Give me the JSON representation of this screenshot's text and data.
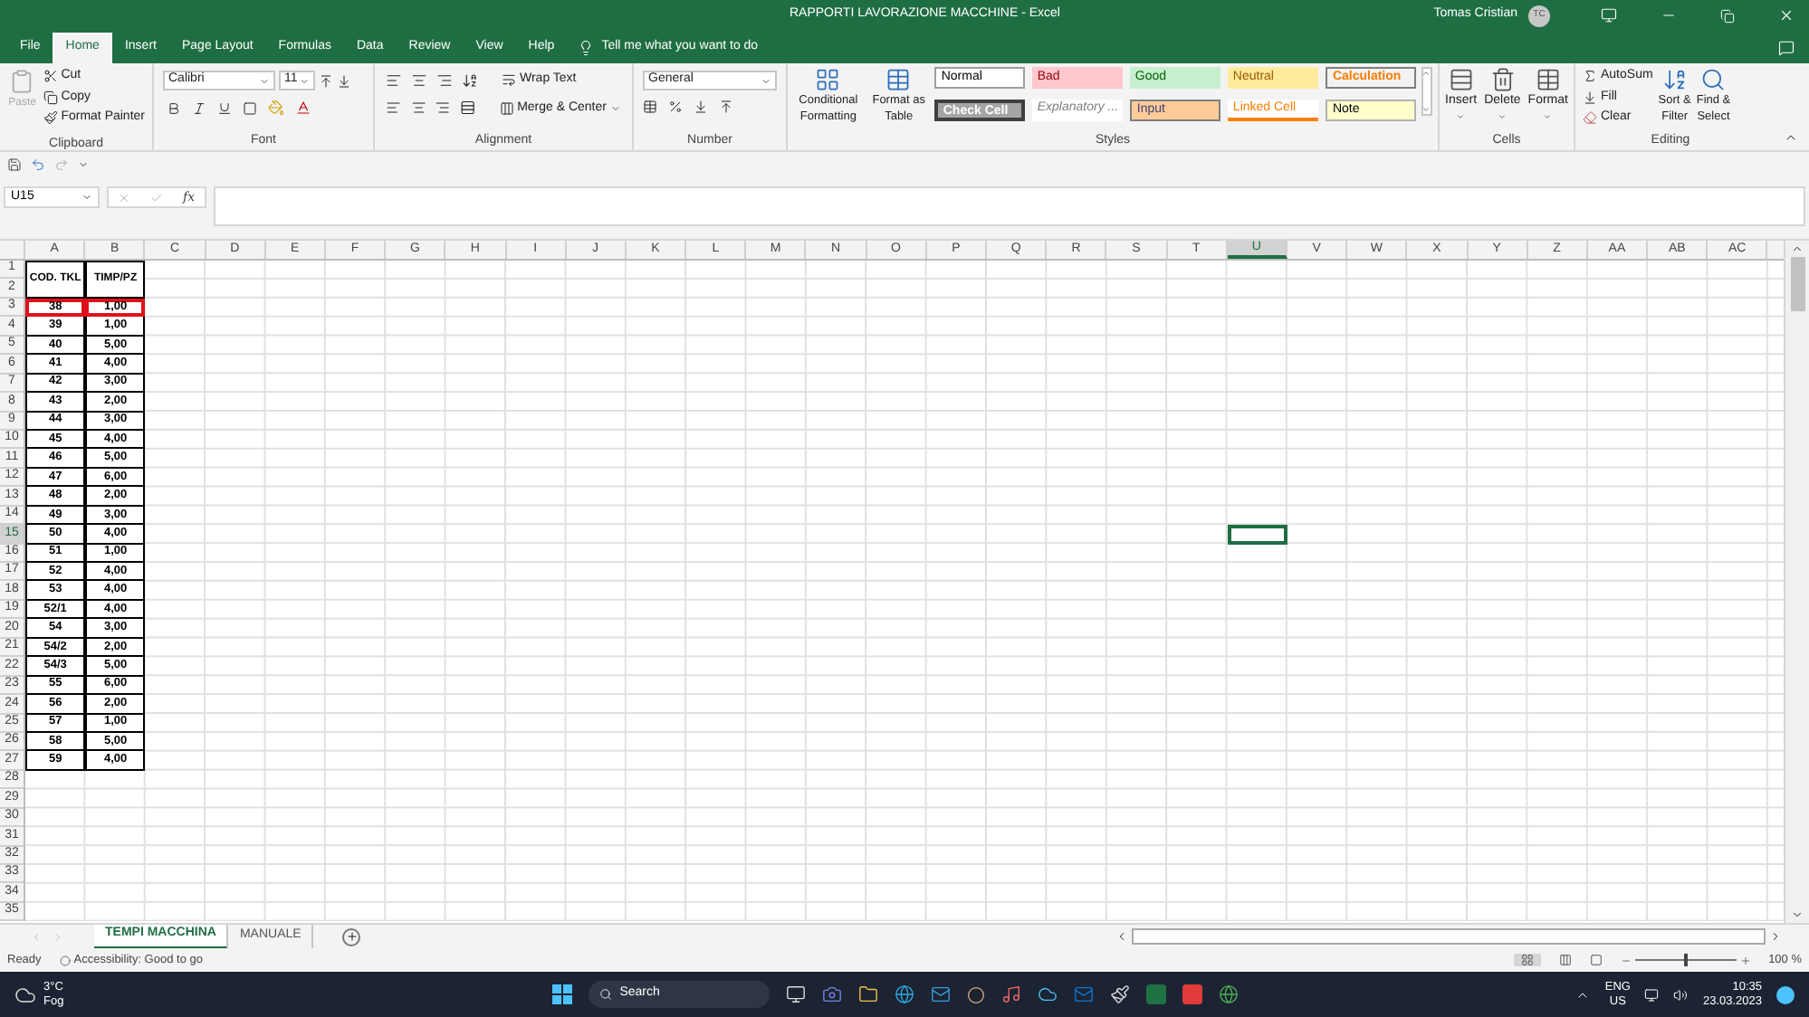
{
  "window": {
    "title": "RAPPORTI LAVORAZIONE MACCHINE  -  Excel",
    "user": "Tomas Cristian",
    "user_initials": "TC"
  },
  "menu_tabs": [
    {
      "label": "File",
      "selected": false
    },
    {
      "label": "Home",
      "selected": true
    },
    {
      "label": "Insert",
      "selected": false
    },
    {
      "label": "Page Layout",
      "selected": false
    },
    {
      "label": "Formulas",
      "selected": false
    },
    {
      "label": "Data",
      "selected": false
    },
    {
      "label": "Review",
      "selected": false
    },
    {
      "label": "View",
      "selected": false
    },
    {
      "label": "Help",
      "selected": false
    }
  ],
  "tell_me": "Tell me what you want to do",
  "ribbon": {
    "clipboard": {
      "label": "Clipboard",
      "paste": {
        "label": "Paste",
        "disabled": true
      },
      "cut": "Cut",
      "copy": "Copy",
      "format_painter": "Format Painter"
    },
    "font": {
      "label": "Font",
      "name": "Calibri",
      "size": "11"
    },
    "alignment": {
      "label": "Alignment",
      "wrap_text": "Wrap Text",
      "merge_center": "Merge & Center"
    },
    "number": {
      "label": "Number",
      "format": "General"
    },
    "styles": {
      "label": "Styles",
      "conditional_formatting": [
        "Conditional",
        "Formatting"
      ],
      "format_as_table": [
        "Format as",
        "Table"
      ],
      "cell_styles": [
        {
          "label": "Normal",
          "kind": "normal"
        },
        {
          "label": "Bad",
          "kind": "bad"
        },
        {
          "label": "Good",
          "kind": "good"
        },
        {
          "label": "Neutral",
          "kind": "neutral"
        },
        {
          "label": "Calculation",
          "kind": "calculation"
        },
        {
          "label": "Check Cell",
          "kind": "check"
        },
        {
          "label": "Explanatory ...",
          "kind": "explanatory"
        },
        {
          "label": "Input",
          "kind": "input"
        },
        {
          "label": "Linked Cell",
          "kind": "linked"
        },
        {
          "label": "Note",
          "kind": "note"
        }
      ]
    },
    "cells": {
      "label": "Cells",
      "insert": "Insert",
      "delete": "Delete",
      "format": "Format"
    },
    "editing": {
      "label": "Editing",
      "autosum": "AutoSum",
      "fill": "Fill",
      "clear": "Clear",
      "sort_filter": [
        "Sort &",
        "Filter"
      ],
      "find_select": [
        "Find &",
        "Select"
      ]
    }
  },
  "formula_bar": {
    "name_box": "U15",
    "function_label": "fx"
  },
  "sheet": {
    "columns": [
      {
        "label": "A",
        "selected": false
      },
      {
        "label": "B",
        "selected": false
      },
      {
        "label": "C",
        "selected": false
      },
      {
        "label": "D",
        "selected": false
      },
      {
        "label": "E",
        "selected": false
      },
      {
        "label": "F",
        "selected": false
      },
      {
        "label": "G",
        "selected": false
      },
      {
        "label": "H",
        "selected": false
      },
      {
        "label": "I",
        "selected": false
      },
      {
        "label": "J",
        "selected": false
      },
      {
        "label": "K",
        "selected": false
      },
      {
        "label": "L",
        "selected": false
      },
      {
        "label": "M",
        "selected": false
      },
      {
        "label": "N",
        "selected": false
      },
      {
        "label": "O",
        "selected": false
      },
      {
        "label": "P",
        "selected": false
      },
      {
        "label": "Q",
        "selected": false
      },
      {
        "label": "R",
        "selected": false
      },
      {
        "label": "S",
        "selected": false
      },
      {
        "label": "T",
        "selected": false
      },
      {
        "label": "U",
        "selected": true
      },
      {
        "label": "V",
        "selected": false
      },
      {
        "label": "W",
        "selected": false
      },
      {
        "label": "X",
        "selected": false
      },
      {
        "label": "Y",
        "selected": false
      },
      {
        "label": "Z",
        "selected": false
      },
      {
        "label": "AA",
        "selected": false
      },
      {
        "label": "AB",
        "selected": false
      },
      {
        "label": "AC",
        "selected": false
      }
    ],
    "header_rows": [
      "1",
      "2"
    ],
    "headers": [
      "COD. TKL",
      "TIMP/PZ"
    ],
    "rows": [
      {
        "label": "3",
        "selected": false,
        "highlighted": true,
        "cells": [
          "38",
          "1,00"
        ]
      },
      {
        "label": "4",
        "selected": false,
        "highlighted": false,
        "cells": [
          "39",
          "1,00"
        ]
      },
      {
        "label": "5",
        "selected": false,
        "highlighted": false,
        "cells": [
          "40",
          "5,00"
        ]
      },
      {
        "label": "6",
        "selected": false,
        "highlighted": false,
        "cells": [
          "41",
          "4,00"
        ]
      },
      {
        "label": "7",
        "selected": false,
        "highlighted": false,
        "cells": [
          "42",
          "3,00"
        ]
      },
      {
        "label": "8",
        "selected": false,
        "highlighted": false,
        "cells": [
          "43",
          "2,00"
        ]
      },
      {
        "label": "9",
        "selected": false,
        "highlighted": false,
        "cells": [
          "44",
          "3,00"
        ]
      },
      {
        "label": "10",
        "selected": false,
        "highlighted": false,
        "cells": [
          "45",
          "4,00"
        ]
      },
      {
        "label": "11",
        "selected": false,
        "highlighted": false,
        "cells": [
          "46",
          "5,00"
        ]
      },
      {
        "label": "12",
        "selected": false,
        "highlighted": false,
        "cells": [
          "47",
          "6,00"
        ]
      },
      {
        "label": "13",
        "selected": false,
        "highlighted": false,
        "cells": [
          "48",
          "2,00"
        ]
      },
      {
        "label": "14",
        "selected": false,
        "highlighted": false,
        "cells": [
          "49",
          "3,00"
        ]
      },
      {
        "label": "15",
        "selected": true,
        "highlighted": false,
        "cells": [
          "50",
          "4,00"
        ]
      },
      {
        "label": "16",
        "selected": false,
        "highlighted": false,
        "cells": [
          "51",
          "1,00"
        ]
      },
      {
        "label": "17",
        "selected": false,
        "highlighted": false,
        "cells": [
          "52",
          "4,00"
        ]
      },
      {
        "label": "18",
        "selected": false,
        "highlighted": false,
        "cells": [
          "53",
          "4,00"
        ]
      },
      {
        "label": "19",
        "selected": false,
        "highlighted": false,
        "cells": [
          "52/1",
          "4,00"
        ]
      },
      {
        "label": "20",
        "selected": false,
        "highlighted": false,
        "cells": [
          "54",
          "3,00"
        ]
      },
      {
        "label": "21",
        "selected": false,
        "highlighted": false,
        "cells": [
          "54/2",
          "2,00"
        ]
      },
      {
        "label": "22",
        "selected": false,
        "highlighted": false,
        "cells": [
          "54/3",
          "5,00"
        ]
      },
      {
        "label": "23",
        "selected": false,
        "highlighted": false,
        "cells": [
          "55",
          "6,00"
        ]
      },
      {
        "label": "24",
        "selected": false,
        "highlighted": false,
        "cells": [
          "56",
          "2,00"
        ]
      },
      {
        "label": "25",
        "selected": false,
        "highlighted": false,
        "cells": [
          "57",
          "1,00"
        ]
      },
      {
        "label": "26",
        "selected": false,
        "highlighted": false,
        "cells": [
          "58",
          "5,00"
        ]
      },
      {
        "label": "27",
        "selected": false,
        "highlighted": false,
        "cells": [
          "59",
          "4,00"
        ]
      },
      {
        "label": "28",
        "selected": false
      },
      {
        "label": "29",
        "selected": false
      },
      {
        "label": "30",
        "selected": false
      },
      {
        "label": "31",
        "selected": false
      },
      {
        "label": "32",
        "selected": false
      },
      {
        "label": "33",
        "selected": false
      },
      {
        "label": "34",
        "selected": false
      },
      {
        "label": "35",
        "selected": false
      }
    ]
  },
  "sheet_tabs": [
    {
      "label": "TEMPI MACCHINA",
      "selected": true
    },
    {
      "label": "MANUALE",
      "selected": false
    }
  ],
  "status_bar": {
    "status": "Ready",
    "accessibility": "Accessibility: Good to go",
    "zoom": "100 %",
    "zoom_slider": {
      "level": 0.5
    }
  },
  "taskbar": {
    "temperature": "3°C",
    "weather": "Fog",
    "search": "Search",
    "language": "ENG",
    "region": "US",
    "time": "10:35",
    "date": "23.03.2023"
  }
}
